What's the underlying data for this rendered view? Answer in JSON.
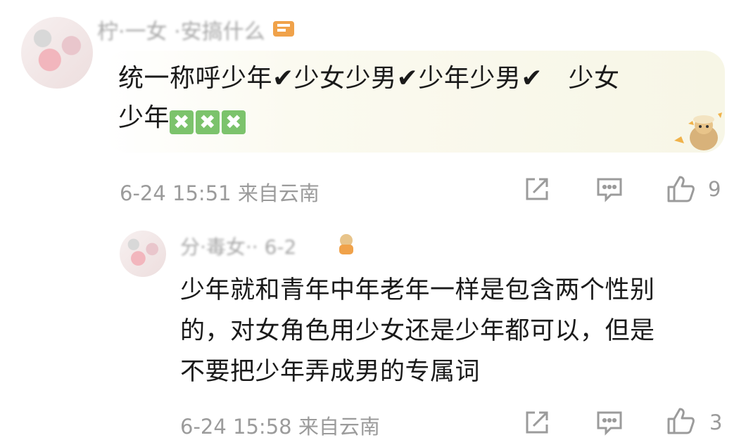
{
  "comments": [
    {
      "username": "柠·一女 ·安搞什么",
      "text_main": "统一称呼少年✔少女少男✔少年少男✔　少女",
      "text_line2": "少年",
      "marks": [
        "✖",
        "✖",
        "✖"
      ],
      "time": "6-24 15:51",
      "location": "来自云南",
      "likes": "9"
    },
    {
      "username": "分·毒女·· 6-2",
      "text": [
        "少年就和青年中年老年一样是包含两个性别",
        "的，对女角色用少女还是少年都可以，但是",
        "不要把少年弄成男的专属词"
      ],
      "time": "6-24 15:58",
      "location": "来自云南",
      "likes": "3"
    }
  ],
  "icons": {
    "share": "share-icon",
    "reply": "comment-icon",
    "like": "thumbs-up-icon"
  },
  "colors": {
    "meta": "#9b9b9b",
    "text": "#1a1a1a",
    "x_mark": "#7cc36c",
    "card_bg": "#f7f6e6"
  }
}
